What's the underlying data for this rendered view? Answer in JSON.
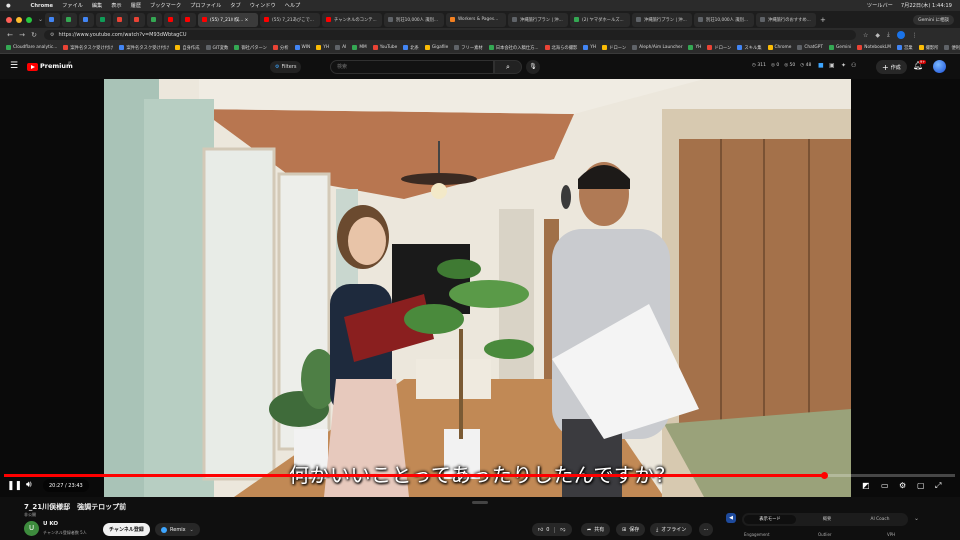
{
  "menubar": {
    "apple": "",
    "app": "Chrome",
    "items": [
      "ファイル",
      "編集",
      "表示",
      "履歴",
      "ブックマーク",
      "プロファイル",
      "タブ",
      "ウィンドウ",
      "ヘルプ"
    ],
    "status": [
      "ツールバー",
      "7月22日(木) 1:44:19"
    ]
  },
  "tabs": [
    {
      "label": "",
      "color": "#4285f4"
    },
    {
      "label": "",
      "color": "#34a853"
    },
    {
      "label": "",
      "color": "#4285f4"
    },
    {
      "label": "",
      "color": "#0f9d58"
    },
    {
      "label": "",
      "color": "#ea4335"
    },
    {
      "label": "",
      "color": "#ea4335"
    },
    {
      "label": "",
      "color": "#34a853"
    },
    {
      "label": "",
      "color": "#ff0000"
    },
    {
      "label": "",
      "color": "#ff0000"
    },
    {
      "label": "(55) 7_21川俣... ×",
      "color": "#ff0000",
      "active": true
    },
    {
      "label": "(55) 7_21あびこで...",
      "color": "#ff0000"
    },
    {
      "label": "チャンネルのコンテ...",
      "color": "#ff0000"
    },
    {
      "label": "別荘10,000人 識別...",
      "color": "#5f6368"
    },
    {
      "label": "Workers & Pages...",
      "color": "#f38020"
    },
    {
      "label": "沖縄旅行プラン | 沖...",
      "color": "#5f6368"
    },
    {
      "label": "(2) ヤマダホールズ...",
      "color": "#34a853"
    },
    {
      "label": "沖縄旅行プラン | 沖...",
      "color": "#5f6368"
    },
    {
      "label": "別荘10,000人 識別...",
      "color": "#5f6368"
    },
    {
      "label": "沖縄旅行のおすすめ...",
      "color": "#5f6368"
    }
  ],
  "gemini_button": "Gemini に相談",
  "address": "https://www.youtube.com/watch?v=M93dWbtagCU",
  "bookmarks": [
    "Cloudflare analytic...",
    "案件名タスク受け付け",
    "案件名タスク受け付け",
    "自身作成",
    "GIT変数",
    "御社パターン",
    "分析",
    "WIN",
    "YH",
    "AI",
    "MM",
    "YouTube",
    "北条",
    "Gigafile",
    "フリー素材",
    "日本会社の入稿仕方...",
    "北海らの撮影",
    "YH",
    "ドローン",
    "Aleph/Aim Launcher",
    "YH",
    "ドローン",
    "スキル集",
    "Chrome",
    "ChatGPT",
    "Gemini",
    "NotebookLM",
    "営業",
    "撮影所",
    "便利サイト"
  ],
  "yt": {
    "logo": "Premium",
    "badge": "JP",
    "filters": "Filters",
    "search_placeholder": "検索",
    "stats": [
      "311",
      "0",
      "50",
      "48"
    ],
    "create": "作成",
    "notif_count": "9+"
  },
  "video": {
    "subtitle": "何かいいことってあったりしたんですか?",
    "time": "20:27 / 23:43",
    "progress": 0.862
  },
  "below": {
    "title": "7_21川俣様邸　強調テロップ前",
    "visibility": "非公開",
    "channel_initial": "U",
    "channel": "U KO",
    "subscribers": "チャンネル登録者数 5人",
    "subscribe": "チャンネル登録",
    "remix": "Remix",
    "likes": "0",
    "share": "共有",
    "save": "保存",
    "offline": "オフライン",
    "studio_tabs": [
      "表示モード",
      "概要",
      "AI Coach"
    ],
    "studio_labels": [
      "Engagement",
      "Outlier",
      "VPH"
    ]
  },
  "colors": {
    "accent": "#ff0000",
    "bg": "#0f0f0f"
  }
}
